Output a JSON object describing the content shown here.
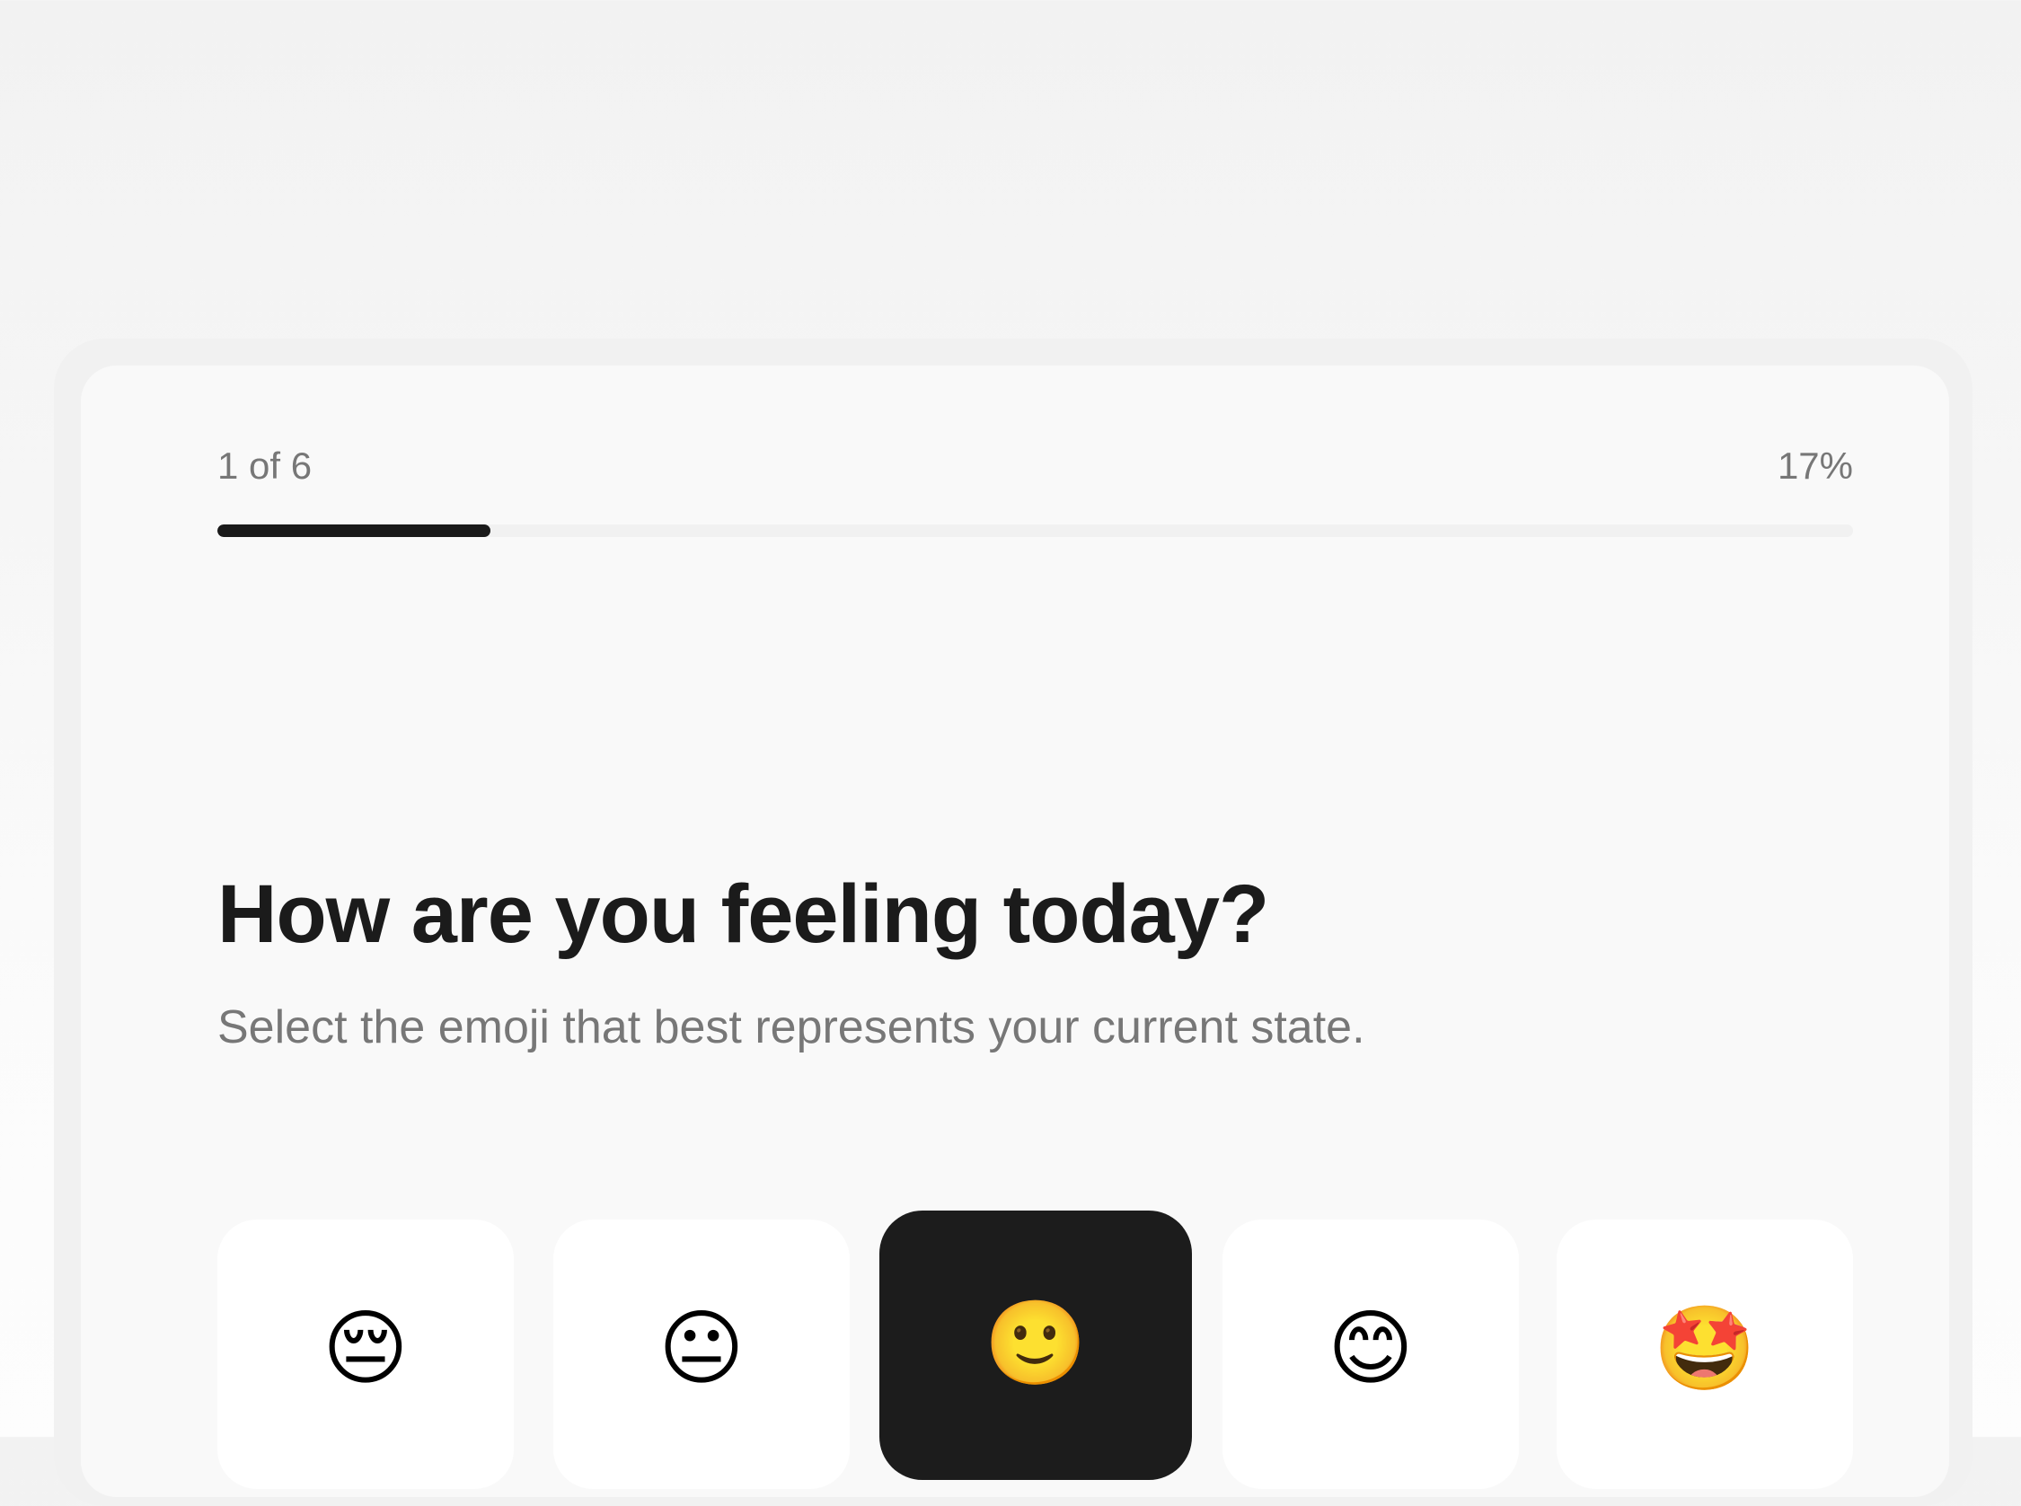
{
  "progress": {
    "step_label": "1 of 6",
    "percent_label": "17%",
    "fraction": 0.167
  },
  "question": {
    "title": "How are you feeling today?",
    "subtitle": "Select the emoji that best represents your current state."
  },
  "options": [
    {
      "emoji": "😔",
      "icon": "pensive-face-icon",
      "selected": false
    },
    {
      "emoji": "😐",
      "icon": "neutral-face-icon",
      "selected": false
    },
    {
      "emoji": "🙂",
      "icon": "slightly-smiling-face-icon",
      "selected": true
    },
    {
      "emoji": "😊",
      "icon": "smiling-face-icon",
      "selected": false
    },
    {
      "emoji": "🤩",
      "icon": "star-struck-face-icon",
      "selected": false
    }
  ],
  "colors": {
    "accent": "#1a1a1a",
    "track": "#f1f1f1",
    "muted_text": "#777777",
    "option_bg": "#ffffff",
    "selected_bg": "#1c1c1c"
  }
}
